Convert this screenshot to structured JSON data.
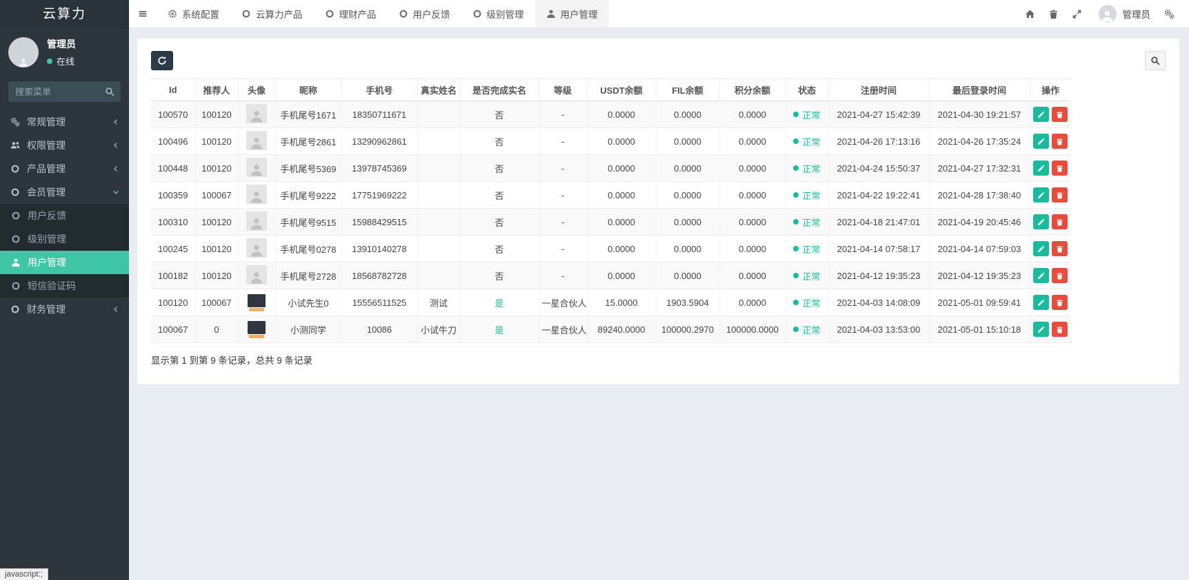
{
  "app": {
    "title": "云算力",
    "status_bar_text": "javascript:;"
  },
  "colors": {
    "accent": "#3fc6a4",
    "success": "#18bc9c",
    "danger": "#e74c3c",
    "sidebar": "#2b353b",
    "dark_button": "#2c3b46"
  },
  "sidebar": {
    "user": {
      "name": "管理员",
      "status": "在线"
    },
    "search": {
      "placeholder": "搜索菜单",
      "icon": "search-icon"
    },
    "items": [
      {
        "id": "general",
        "label": "常规管理",
        "icon": "gears-icon",
        "chevron": "left"
      },
      {
        "id": "permission",
        "label": "权限管理",
        "icon": "users-icon",
        "chevron": "left"
      },
      {
        "id": "product",
        "label": "产品管理",
        "icon": "circle-icon",
        "chevron": "left"
      },
      {
        "id": "member",
        "label": "会员管理",
        "icon": "circle-icon",
        "chevron": "down",
        "expanded": true,
        "children": [
          {
            "id": "user-feedback",
            "label": "用户反馈",
            "icon": "circle-icon"
          },
          {
            "id": "level-management",
            "label": "级别管理",
            "icon": "circle-icon"
          },
          {
            "id": "user-management",
            "label": "用户管理",
            "icon": "user-icon",
            "active": true
          },
          {
            "id": "sms-code",
            "label": "短信验证码",
            "icon": "circle-icon"
          }
        ]
      },
      {
        "id": "finance",
        "label": "财务管理",
        "icon": "circle-icon",
        "chevron": "left"
      }
    ]
  },
  "navbar": {
    "tabs": [
      {
        "id": "system-config",
        "label": "系统配置",
        "icon": "gear-icon"
      },
      {
        "id": "cloud-products",
        "label": "云算力产品",
        "icon": "circle-icon"
      },
      {
        "id": "finance-products",
        "label": "理财产品",
        "icon": "circle-icon"
      },
      {
        "id": "user-feedback",
        "label": "用户反馈",
        "icon": "circle-icon"
      },
      {
        "id": "level-management",
        "label": "级别管理",
        "icon": "circle-icon"
      },
      {
        "id": "user-management",
        "label": "用户管理",
        "icon": "user-icon",
        "active": true
      }
    ],
    "right": {
      "icons": [
        {
          "id": "home",
          "icon": "home-icon"
        },
        {
          "id": "clear",
          "icon": "trash-icon"
        },
        {
          "id": "fullscreen",
          "icon": "expand-icon"
        }
      ],
      "user_name": "管理员",
      "settings_icon": "gears-icon"
    }
  },
  "table": {
    "headers": [
      "Id",
      "推荐人",
      "头像",
      "昵称",
      "手机号",
      "真实姓名",
      "是否完成实名",
      "等级",
      "USDT余额",
      "FIL余额",
      "积分余额",
      "状态",
      "注册时间",
      "最后登录时间",
      "操作"
    ],
    "rows": [
      {
        "id": "100570",
        "referrer": "100120",
        "avatar": "placeholder",
        "nickname": "手机尾号1671",
        "phone": "18350711671",
        "real_name": "",
        "verified": "否",
        "level": "-",
        "usdt": "0.0000",
        "fil": "0.0000",
        "points": "0.0000",
        "status": "正常",
        "registered": "2021-04-27 15:42:39",
        "last_login": "2021-04-30 19:21:57"
      },
      {
        "id": "100496",
        "referrer": "100120",
        "avatar": "placeholder",
        "nickname": "手机尾号2861",
        "phone": "13290962861",
        "real_name": "",
        "verified": "否",
        "level": "-",
        "usdt": "0.0000",
        "fil": "0.0000",
        "points": "0.0000",
        "status": "正常",
        "registered": "2021-04-26 17:13:16",
        "last_login": "2021-04-26 17:35:24"
      },
      {
        "id": "100448",
        "referrer": "100120",
        "avatar": "placeholder",
        "nickname": "手机尾号5369",
        "phone": "13978745369",
        "real_name": "",
        "verified": "否",
        "level": "-",
        "usdt": "0.0000",
        "fil": "0.0000",
        "points": "0.0000",
        "status": "正常",
        "registered": "2021-04-24 15:50:37",
        "last_login": "2021-04-27 17:32:31"
      },
      {
        "id": "100359",
        "referrer": "100067",
        "avatar": "placeholder",
        "nickname": "手机尾号9222",
        "phone": "17751969222",
        "real_name": "",
        "verified": "否",
        "level": "-",
        "usdt": "0.0000",
        "fil": "0.0000",
        "points": "0.0000",
        "status": "正常",
        "registered": "2021-04-22 19:22:41",
        "last_login": "2021-04-28 17:38:40"
      },
      {
        "id": "100310",
        "referrer": "100120",
        "avatar": "placeholder",
        "nickname": "手机尾号9515",
        "phone": "15988429515",
        "real_name": "",
        "verified": "否",
        "level": "-",
        "usdt": "0.0000",
        "fil": "0.0000",
        "points": "0.0000",
        "status": "正常",
        "registered": "2021-04-18 21:47:01",
        "last_login": "2021-04-19 20:45:46"
      },
      {
        "id": "100245",
        "referrer": "100120",
        "avatar": "placeholder",
        "nickname": "手机尾号0278",
        "phone": "13910140278",
        "real_name": "",
        "verified": "否",
        "level": "-",
        "usdt": "0.0000",
        "fil": "0.0000",
        "points": "0.0000",
        "status": "正常",
        "registered": "2021-04-14 07:58:17",
        "last_login": "2021-04-14 07:59:03"
      },
      {
        "id": "100182",
        "referrer": "100120",
        "avatar": "placeholder",
        "nickname": "手机尾号2728",
        "phone": "18568782728",
        "real_name": "",
        "verified": "否",
        "level": "-",
        "usdt": "0.0000",
        "fil": "0.0000",
        "points": "0.0000",
        "status": "正常",
        "registered": "2021-04-12 19:35:23",
        "last_login": "2021-04-12 19:35:23"
      },
      {
        "id": "100120",
        "referrer": "100067",
        "avatar": "photo",
        "nickname": "小试先生0",
        "phone": "15556511525",
        "real_name": "测试",
        "verified": "是",
        "level": "一星合伙人",
        "usdt": "15.0000",
        "fil": "1903.5904",
        "points": "0.0000",
        "status": "正常",
        "registered": "2021-04-03 14:08:09",
        "last_login": "2021-05-01 09:59:41"
      },
      {
        "id": "100067",
        "referrer": "0",
        "avatar": "photo",
        "nickname": "小测同学",
        "phone": "10086",
        "real_name": "小试牛刀",
        "verified": "是",
        "level": "一星合伙人",
        "usdt": "89240.0000",
        "fil": "100000.2970",
        "points": "100000.0000",
        "status": "正常",
        "registered": "2021-04-03 13:53:00",
        "last_login": "2021-05-01 15:10:18"
      }
    ],
    "footer": "显示第 1 到第 9 条记录，总共 9 条记录"
  }
}
